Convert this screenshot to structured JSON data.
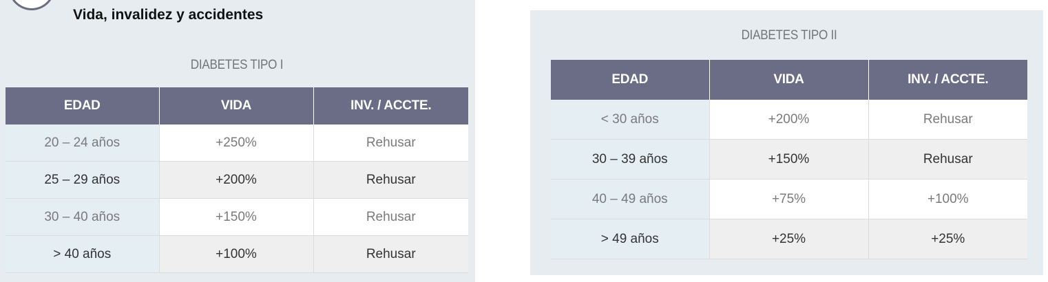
{
  "left_section": {
    "heading": "Vida, invalidez y accidentes",
    "table": {
      "title": "DIABETES TIPO I",
      "headers": [
        "EDAD",
        "VIDA",
        "INV. / ACCTE."
      ],
      "rows": [
        [
          "20 – 24 años",
          "+250%",
          "Rehusar"
        ],
        [
          "25 – 29 años",
          "+200%",
          "Rehusar"
        ],
        [
          "30 – 40 años",
          "+150%",
          "Rehusar"
        ],
        [
          "> 40 años",
          "+100%",
          "Rehusar"
        ]
      ]
    }
  },
  "right_section": {
    "table": {
      "title": "DIABETES TIPO II",
      "headers": [
        "EDAD",
        "VIDA",
        "INV. / ACCTE."
      ],
      "rows": [
        [
          "< 30 años",
          "+200%",
          "Rehusar"
        ],
        [
          "30 – 39 años",
          "+150%",
          "Rehusar"
        ],
        [
          "40 – 49 años",
          "+75%",
          "+100%"
        ],
        [
          "> 49 años",
          "+25%",
          "+25%"
        ]
      ]
    }
  },
  "colors": {
    "panel_background": "#e6ecf0",
    "header_background": "#6b6d87",
    "age_column_background": "#e4eef3",
    "striped_row_background": "#efefef"
  },
  "icons": {
    "logo": "circle-logo-icon"
  }
}
